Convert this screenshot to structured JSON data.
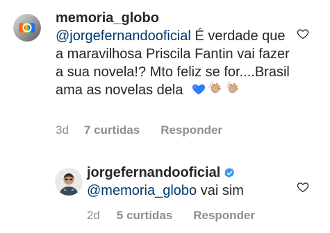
{
  "comments": [
    {
      "username": "memoria_globo",
      "mention": "@jorgefernandooficial",
      "text": "É verdade que a maravilhosa Priscila Fantin vai fazer a sua novela!? Mto feliz se for....Brasil ama as novelas dela",
      "emojis": [
        "blue-heart-icon",
        "clapping-hands-icon",
        "clapping-hands-icon"
      ],
      "time": "3d",
      "likes": "7 curtidas",
      "reply": "Responder"
    },
    {
      "username": "jorgefernandooficial",
      "verified": true,
      "mention": "@memoria_globo",
      "text": "vai sim",
      "time": "2d",
      "likes": "5 curtidas",
      "reply": "Responder"
    }
  ],
  "colors": {
    "text": "#262626",
    "mention": "#00376b",
    "meta": "#8e8e8e",
    "verified": "#3897f0"
  }
}
